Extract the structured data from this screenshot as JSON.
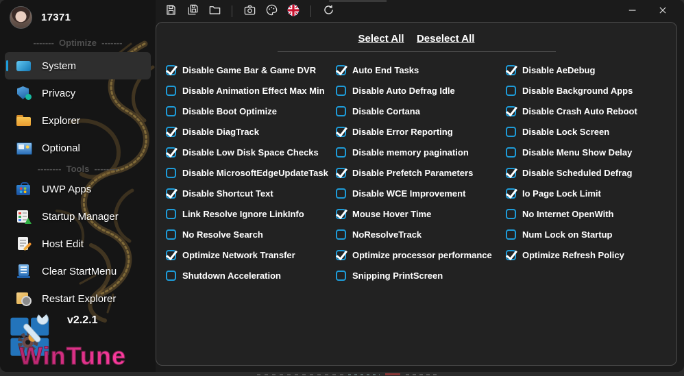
{
  "user": {
    "name": "17371"
  },
  "titlebar": {
    "toolbar_icons": [
      "save-icon",
      "save-all-icon",
      "open-folder-icon",
      "screenshot-camera-icon",
      "theme-palette-icon",
      "language-flag-uk-icon",
      "refresh-icon"
    ],
    "window_controls": [
      "minimize-icon",
      "close-icon"
    ]
  },
  "sidebar": {
    "optimize_divider": "-------  Optimize  -------",
    "tools_divider": "--------  Tools  --------",
    "optimize_items": [
      {
        "label": "System",
        "icon": "system-icon",
        "selected": true
      },
      {
        "label": "Privacy",
        "icon": "privacy-icon",
        "selected": false
      },
      {
        "label": "Explorer",
        "icon": "explorer-icon",
        "selected": false
      },
      {
        "label": "Optional",
        "icon": "optional-icon",
        "selected": false
      }
    ],
    "tools_items": [
      {
        "label": "UWP Apps",
        "icon": "uwp-apps-icon",
        "selected": false
      },
      {
        "label": "Startup Manager",
        "icon": "startup-manager-icon",
        "selected": false
      },
      {
        "label": "Host Edit",
        "icon": "host-edit-icon",
        "selected": false
      },
      {
        "label": "Clear StartMenu",
        "icon": "clear-startmenu-icon",
        "selected": false
      },
      {
        "label": "Restart Explorer",
        "icon": "restart-explorer-icon",
        "selected": false
      }
    ],
    "version": "v2.2.1",
    "brand": "WinTune"
  },
  "main": {
    "select_all": "Select All",
    "deselect_all": "Deselect All",
    "columns": [
      {
        "items": [
          {
            "label": "Disable Game Bar & Game DVR",
            "checked": true
          },
          {
            "label": "Disable Animation Effect Max Min",
            "checked": false
          },
          {
            "label": "Disable Boot Optimize",
            "checked": false
          },
          {
            "label": "Disable DiagTrack",
            "checked": true
          },
          {
            "label": "Disable Low Disk Space Checks",
            "checked": true
          },
          {
            "label": "Disable MicrosoftEdgeUpdateTask",
            "checked": false
          },
          {
            "label": "Disable Shortcut Text",
            "checked": true
          },
          {
            "label": "Link Resolve Ignore LinkInfo",
            "checked": false
          },
          {
            "label": "No Resolve Search",
            "checked": false
          },
          {
            "label": "Optimize Network Transfer",
            "checked": true
          },
          {
            "label": "Shutdown Acceleration",
            "checked": false
          }
        ]
      },
      {
        "items": [
          {
            "label": "Auto End Tasks",
            "checked": true
          },
          {
            "label": "Disable Auto Defrag Idle",
            "checked": false
          },
          {
            "label": "Disable Cortana",
            "checked": false
          },
          {
            "label": "Disable Error Reporting",
            "checked": true
          },
          {
            "label": "Disable memory pagination",
            "checked": false
          },
          {
            "label": "Disable Prefetch Parameters",
            "checked": true
          },
          {
            "label": "Disable WCE Improvement",
            "checked": false
          },
          {
            "label": "Mouse Hover Time",
            "checked": true
          },
          {
            "label": "NoResolveTrack",
            "checked": false
          },
          {
            "label": "Optimize processor performance",
            "checked": true
          },
          {
            "label": "Snipping PrintScreen",
            "checked": false
          }
        ]
      },
      {
        "items": [
          {
            "label": "Disable AeDebug",
            "checked": true
          },
          {
            "label": "Disable Background Apps",
            "checked": false
          },
          {
            "label": "Disable Crash Auto Reboot",
            "checked": true
          },
          {
            "label": "Disable Lock Screen",
            "checked": false
          },
          {
            "label": "Disable Menu Show Delay",
            "checked": false
          },
          {
            "label": "Disable Scheduled Defrag",
            "checked": true
          },
          {
            "label": "Io Page Lock Limit",
            "checked": true
          },
          {
            "label": "No Internet OpenWith",
            "checked": false
          },
          {
            "label": "Num Lock on Startup",
            "checked": false
          },
          {
            "label": "Optimize Refresh Policy",
            "checked": true
          }
        ]
      }
    ]
  },
  "colors": {
    "accent": "#1e9cd9",
    "brand_gradient_start": "#b5256b",
    "brand_gradient_end": "#ff3ba0"
  }
}
